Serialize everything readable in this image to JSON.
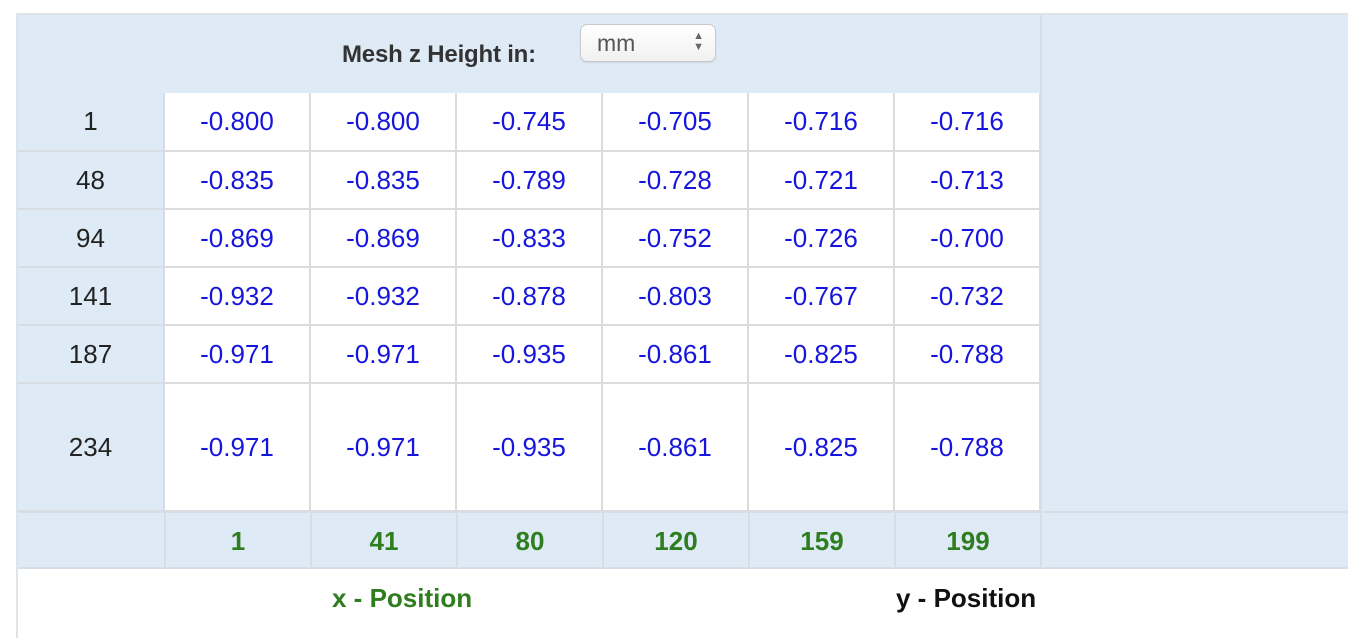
{
  "header": {
    "title": "Mesh z Height in:",
    "unit_value": "mm"
  },
  "colors": {
    "header_bg": "#deebf7",
    "value_text": "#1515dd",
    "x_axis_text": "#2e7d1e"
  },
  "mesh": {
    "y_positions": [
      "1",
      "48",
      "94",
      "141",
      "187",
      "234"
    ],
    "x_positions": [
      "1",
      "41",
      "80",
      "120",
      "159",
      "199"
    ],
    "rows": [
      [
        "-0.800",
        "-0.800",
        "-0.745",
        "-0.705",
        "-0.716",
        "-0.716"
      ],
      [
        "-0.835",
        "-0.835",
        "-0.789",
        "-0.728",
        "-0.721",
        "-0.713"
      ],
      [
        "-0.869",
        "-0.869",
        "-0.833",
        "-0.752",
        "-0.726",
        "-0.700"
      ],
      [
        "-0.932",
        "-0.932",
        "-0.878",
        "-0.803",
        "-0.767",
        "-0.732"
      ],
      [
        "-0.971",
        "-0.971",
        "-0.935",
        "-0.861",
        "-0.825",
        "-0.788"
      ],
      [
        "-0.971",
        "-0.971",
        "-0.935",
        "-0.861",
        "-0.825",
        "-0.788"
      ]
    ]
  },
  "labels": {
    "x_axis": "x - Position",
    "y_axis": "y - Position"
  },
  "icons": {
    "unit_select_arrows": "updown-chevron-icon"
  }
}
